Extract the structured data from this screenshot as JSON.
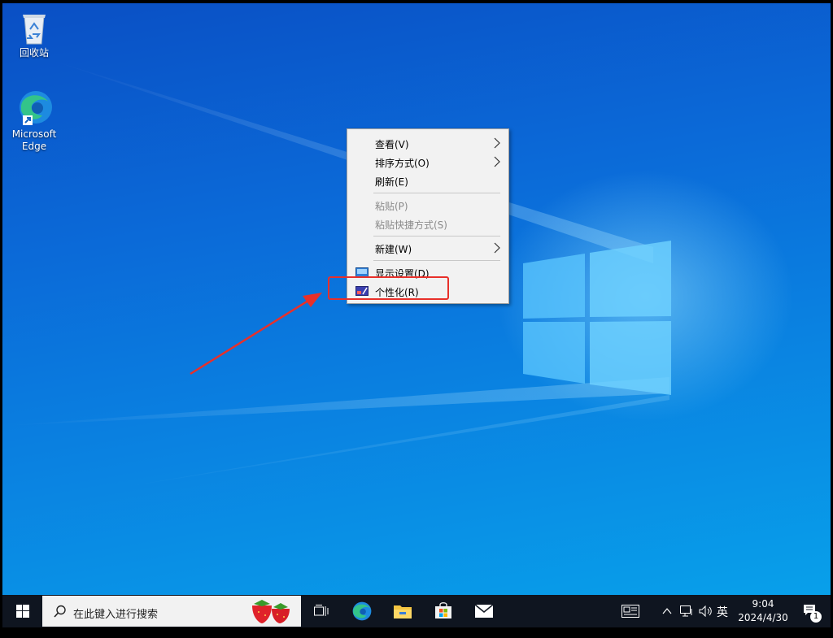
{
  "desktop": {
    "icons": [
      {
        "label": "回收站",
        "icon": "recycle-bin-icon"
      },
      {
        "label": "Microsoft Edge",
        "icon": "edge-icon"
      }
    ]
  },
  "context_menu": {
    "items": [
      {
        "label": "查看(V)",
        "enabled": true,
        "submenu": true
      },
      {
        "label": "排序方式(O)",
        "enabled": true,
        "submenu": true
      },
      {
        "label": "刷新(E)",
        "enabled": true
      },
      {
        "label": "粘贴(P)",
        "enabled": false
      },
      {
        "label": "粘贴快捷方式(S)",
        "enabled": false
      },
      {
        "label": "新建(W)",
        "enabled": true,
        "submenu": true
      },
      {
        "label": "显示设置(D)",
        "enabled": true,
        "icon": "display-settings-icon"
      },
      {
        "label": "个性化(R)",
        "enabled": true,
        "icon": "personalize-icon",
        "highlighted": true
      }
    ]
  },
  "taskbar": {
    "search_placeholder": "在此键入进行搜索",
    "pinned": [
      "task-view-icon",
      "edge-icon",
      "file-explorer-icon",
      "store-icon",
      "mail-icon"
    ],
    "tray": {
      "ime": "英",
      "time": "9:04",
      "date": "2024/4/30",
      "notification_count": "1"
    }
  },
  "colors": {
    "annotation": "#e8302a",
    "taskbar": "#0f1520",
    "menu_bg": "#f2f2f2"
  }
}
